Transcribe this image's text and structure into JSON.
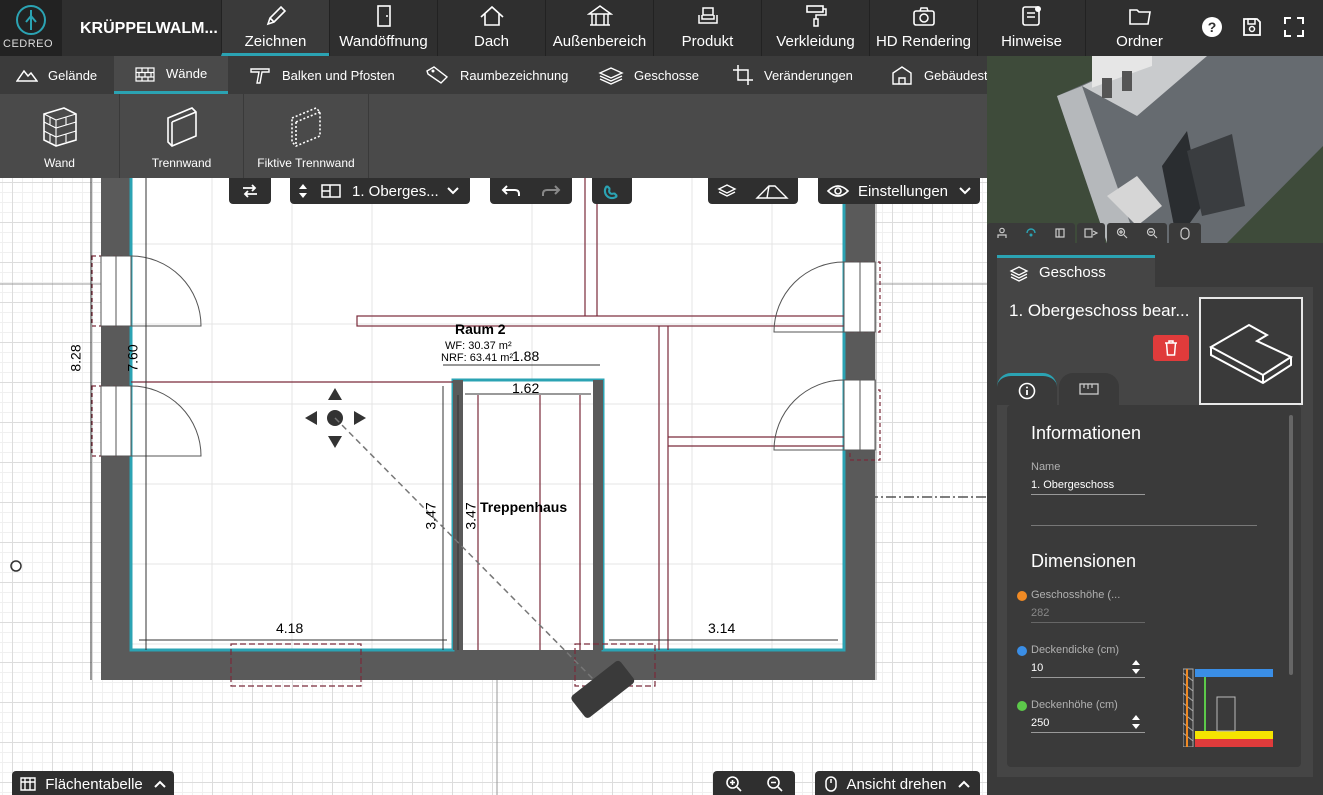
{
  "app": {
    "logo_text": "CEDREO",
    "project_title": "KRÜPPELWALM..."
  },
  "topnav": [
    {
      "label": "Zeichnen",
      "icon": "pencil-icon"
    },
    {
      "label": "Wandöffnung",
      "icon": "door-icon"
    },
    {
      "label": "Dach",
      "icon": "roof-icon"
    },
    {
      "label": "Außenbereich",
      "icon": "gazebo-icon"
    },
    {
      "label": "Produkt",
      "icon": "sofa-icon"
    },
    {
      "label": "Verkleidung",
      "icon": "paint-roller-icon"
    },
    {
      "label": "HD Rendering",
      "icon": "camera-icon"
    },
    {
      "label": "Hinweise",
      "icon": "notes-icon"
    },
    {
      "label": "Ordner",
      "icon": "folder-icon"
    }
  ],
  "topbar_icons": [
    "help-icon",
    "save-icon",
    "fullscreen-icon"
  ],
  "subnav": [
    {
      "label": "Gelände",
      "icon": "terrain-icon"
    },
    {
      "label": "Wände",
      "icon": "brick-wall-icon"
    },
    {
      "label": "Balken und Pfosten",
      "icon": "beam-icon"
    },
    {
      "label": "Raumbezeichnung",
      "icon": "tag-icon"
    },
    {
      "label": "Geschosse",
      "icon": "layers-icon"
    },
    {
      "label": "Veränderungen",
      "icon": "crop-icon"
    },
    {
      "label": "Gebäudesta",
      "icon": "building-icon"
    }
  ],
  "tools": [
    {
      "label": "Wand"
    },
    {
      "label": "Trennwand"
    },
    {
      "label": "Fiktive Trennwand"
    }
  ],
  "canvas_toolbar": {
    "floor_select": "1. Oberges...",
    "settings_label": "Einstellungen"
  },
  "plan": {
    "room_name": "Raum 2",
    "room_wf": "WF: 30.37 m²",
    "room_nrf": "NRF: 63.41 m²",
    "stair_name": "Treppenhaus",
    "dims": {
      "outer_height": "8.28",
      "inner_height": "7.60",
      "stair_top": "1.88",
      "stair_inner": "1.62",
      "stair_height_left": "3.47",
      "stair_height_right": "3.47",
      "room_left_width": "4.18",
      "room_right_width": "3.14"
    }
  },
  "bottom_bar": {
    "area_table": "Flächentabelle",
    "rotate_view": "Ansicht drehen"
  },
  "right_panel": {
    "tab_label": "Geschoss",
    "object_title": "1. Obergeschoss bear...",
    "info_title": "Informationen",
    "name_label": "Name",
    "name_value": "1. Obergeschoss",
    "dimensions_title": "Dimensionen",
    "storey_height_label": "Geschosshöhe (...",
    "storey_height_value": "282",
    "slab_thickness_label": "Deckendicke (cm)",
    "slab_thickness_value": "10",
    "ceiling_height_label": "Deckenhöhe (cm)",
    "ceiling_height_value": "250"
  },
  "colors": {
    "accent": "#2ba3b3",
    "delete": "#e03b3b",
    "storey_dot": "#f08a24",
    "slab_dot": "#3a8ee6",
    "ceiling_dot": "#5cc94a"
  }
}
